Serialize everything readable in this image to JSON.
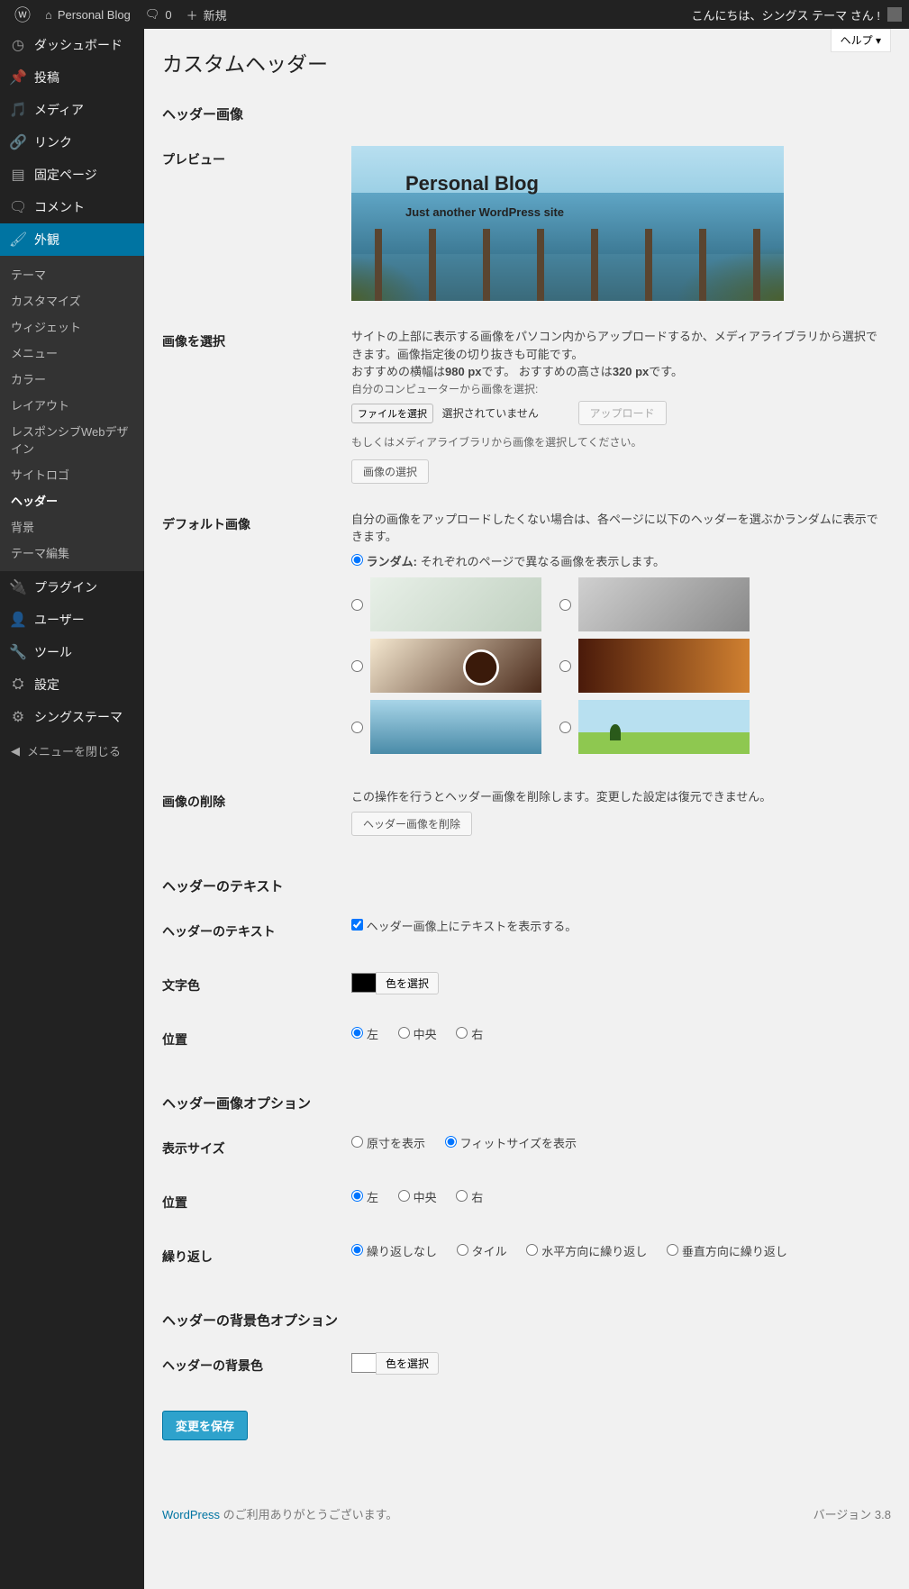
{
  "adminbar": {
    "site_name": "Personal Blog",
    "comments": "0",
    "new": "新規",
    "greeting": "こんにちは、シングス テーマ さん !"
  },
  "sidebar": {
    "dashboard": "ダッシュボード",
    "posts": "投稿",
    "media": "メディア",
    "links": "リンク",
    "pages": "固定ページ",
    "comments": "コメント",
    "appearance": "外観",
    "submenu": {
      "themes": "テーマ",
      "customize": "カスタマイズ",
      "widgets": "ウィジェット",
      "menus": "メニュー",
      "color": "カラー",
      "layout": "レイアウト",
      "responsive": "レスポンシブWebデザイン",
      "sitelogo": "サイトロゴ",
      "header": "ヘッダー",
      "background": "背景",
      "editor": "テーマ編集"
    },
    "plugins": "プラグイン",
    "users": "ユーザー",
    "tools": "ツール",
    "settings": "設定",
    "things_theme": "シングステーマ",
    "collapse": "メニューを閉じる"
  },
  "help": "ヘルプ ▾",
  "page_title": "カスタムヘッダー",
  "sections": {
    "header_image": "ヘッダー画像",
    "header_text": "ヘッダーのテキスト",
    "header_image_option": "ヘッダー画像オプション",
    "header_bg_option": "ヘッダーの背景色オプション"
  },
  "rows": {
    "preview": "プレビュー",
    "select_image": "画像を選択",
    "default_images": "デフォルト画像",
    "remove_image": "画像の削除",
    "header_text_row": "ヘッダーのテキスト",
    "text_color": "文字色",
    "position": "位置",
    "display_size": "表示サイズ",
    "repeat": "繰り返し",
    "header_bg": "ヘッダーの背景色"
  },
  "preview": {
    "site_title": "Personal Blog",
    "tagline": "Just another WordPress site"
  },
  "select_image": {
    "desc1": "サイトの上部に表示する画像をパソコン内からアップロードするか、メディアライブラリから選択できます。画像指定後の切り抜きも可能です。",
    "desc2_a": "おすすめの横幅は",
    "desc2_w": "980 px",
    "desc2_b": "です。 おすすめの高さは",
    "desc2_h": "320 px",
    "desc2_c": "です。",
    "from_pc": "自分のコンピューターから画像を選択:",
    "choose_file": "ファイルを選択",
    "no_file": "選択されていません",
    "upload": "アップロード",
    "or_media": "もしくはメディアライブラリから画像を選択してください。",
    "choose_image": "画像の選択"
  },
  "default_images": {
    "desc": "自分の画像をアップロードしたくない場合は、各ページに以下のヘッダーを選ぶかランダムに表示できます。",
    "random_label_a": "ランダム:",
    "random_label_b": " それぞれのページで異なる画像を表示します。"
  },
  "remove_image": {
    "desc": "この操作を行うとヘッダー画像を削除します。変更した設定は復元できません。",
    "button": "ヘッダー画像を削除"
  },
  "header_text": {
    "checkbox_label": "ヘッダー画像上にテキストを表示する。",
    "color_select": "色を選択"
  },
  "position_opts": {
    "left": "左",
    "center": "中央",
    "right": "右"
  },
  "size_opts": {
    "original": "原寸を表示",
    "fit": "フィットサイズを表示"
  },
  "repeat_opts": {
    "none": "繰り返しなし",
    "tile": "タイル",
    "horiz": "水平方向に繰り返し",
    "vert": "垂直方向に繰り返し"
  },
  "bg_color": {
    "select": "色を選択"
  },
  "submit": "変更を保存",
  "footer": {
    "thanks_a": "WordPress",
    "thanks_b": " のご利用ありがとうございます。",
    "version": "バージョン 3.8"
  }
}
